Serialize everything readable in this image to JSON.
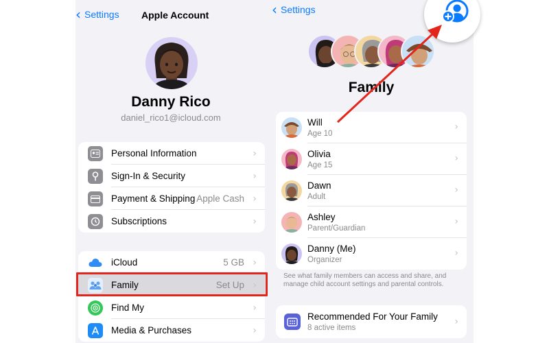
{
  "colors": {
    "accent": "#0a7aff",
    "highlight": "#e3261c",
    "background": "#f2f2f7"
  },
  "left": {
    "back_label": "Settings",
    "title": "Apple Account",
    "profile": {
      "name": "Danny Rico",
      "email": "daniel_rico1@icloud.com"
    },
    "account_items": [
      {
        "label": "Personal Information",
        "value": "",
        "icon": "id-card-icon"
      },
      {
        "label": "Sign-In & Security",
        "value": "",
        "icon": "key-icon"
      },
      {
        "label": "Payment & Shipping",
        "value": "Apple Cash",
        "icon": "credit-card-icon"
      },
      {
        "label": "Subscriptions",
        "value": "",
        "icon": "subscriptions-icon"
      }
    ],
    "service_items": [
      {
        "label": "iCloud",
        "value": "5 GB",
        "icon": "cloud-icon"
      },
      {
        "label": "Family",
        "value": "Set Up",
        "icon": "family-icon"
      },
      {
        "label": "Find My",
        "value": "",
        "icon": "find-my-icon"
      },
      {
        "label": "Media & Purchases",
        "value": "",
        "icon": "app-store-icon"
      }
    ]
  },
  "right": {
    "back_label": "Settings",
    "title": "Family",
    "members": [
      {
        "name": "Will",
        "role": "Age 10"
      },
      {
        "name": "Olivia",
        "role": "Age 15"
      },
      {
        "name": "Dawn",
        "role": "Adult"
      },
      {
        "name": "Ashley",
        "role": "Parent/Guardian"
      },
      {
        "name": "Danny (Me)",
        "role": "Organizer"
      }
    ],
    "footnote": "See what family members can access and share, and manage child account settings and parental controls.",
    "recommended": {
      "title": "Recommended For Your Family",
      "subtitle": "8 active items"
    }
  }
}
